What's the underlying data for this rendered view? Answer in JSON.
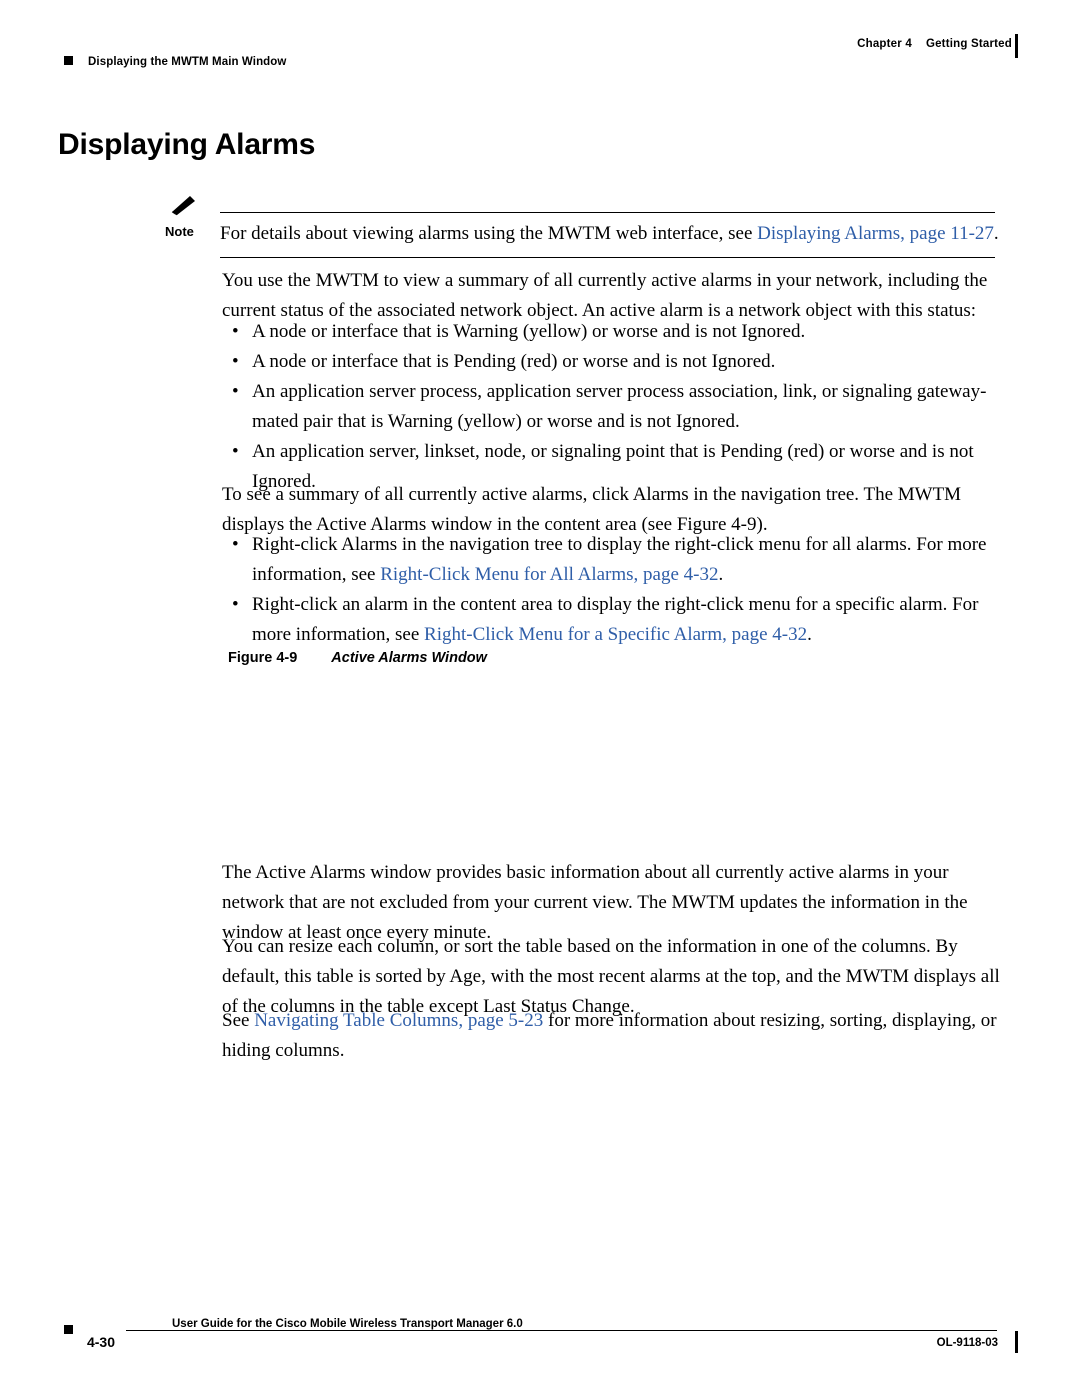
{
  "header": {
    "chapter_label": "Chapter 4",
    "chapter_title": "Getting Started",
    "running_head": "Displaying the MWTM Main Window"
  },
  "title": "Displaying Alarms",
  "note": {
    "label": "Note",
    "text_before_link": "For details about viewing alarms using the MWTM web interface, see ",
    "link": "Displaying Alarms, page 11-27",
    "text_after_link": "."
  },
  "paragraphs": {
    "intro": "You use the MWTM to view a summary of all currently active alarms in your network, including the current status of the associated network object. An active alarm is a network object with this status:",
    "summary_lead": "To see a summary of all currently active alarms, click Alarms in the navigation tree. The MWTM displays the Active Alarms window in the content area (see Figure 4-9).",
    "after_figure_1": "The Active Alarms window provides basic information about all currently active alarms in your network that are not excluded from your current view. The MWTM updates the information in the window at least once every minute.",
    "after_figure_2": "You can resize each column, or sort the table based on the information in one of the columns. By default, this table is sorted by Age, with the most recent alarms at the top, and the MWTM displays all of the columns in the table except Last Status Change."
  },
  "bullets_status": [
    "A node or interface that is Warning (yellow) or worse and is not Ignored.",
    "A node or interface that is Pending (red) or worse and is not Ignored.",
    "An application server process, application server process association, link, or signaling gateway-mated pair that is Warning (yellow) or worse and is not Ignored.",
    "An application server, linkset, node, or signaling point that is Pending (red) or worse and is not Ignored."
  ],
  "bullets_rightclick": [
    {
      "before": "Right-click Alarms in the navigation tree to display the right-click menu for all alarms. For more information, see ",
      "link": "Right-Click Menu for All Alarms, page 4-32",
      "after": "."
    },
    {
      "before": "Right-click an alarm in the content area to display the right-click menu for a specific alarm. For more information, see ",
      "link": "Right-Click Menu for a Specific Alarm, page 4-32",
      "after": "."
    }
  ],
  "see_also": {
    "before": "See ",
    "link": "Navigating Table Columns, page 5-23",
    "after": " for more information about resizing, sorting, displaying, or hiding columns."
  },
  "figure": {
    "number": "Figure 4-9",
    "caption": "Active Alarms Window"
  },
  "footer": {
    "book_title": "User Guide for the Cisco Mobile Wireless Transport Manager 6.0",
    "page_number": "4-30",
    "doc_id": "OL-9118-03"
  },
  "colors": {
    "link": "#2f5ea8",
    "text": "#000000",
    "background": "#ffffff"
  }
}
